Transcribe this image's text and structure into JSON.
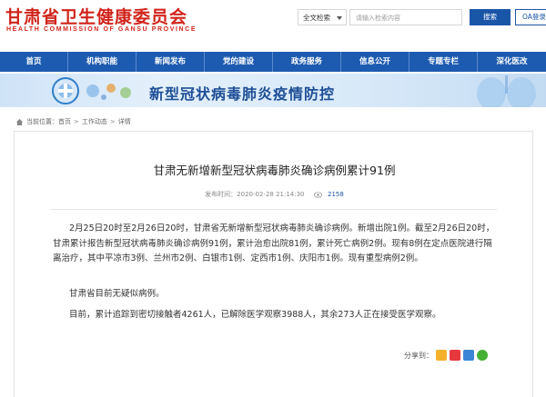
{
  "header": {
    "site_title": "甘肃省卫生健康委员会",
    "site_subtitle": "HEALTH COMMISSION OF GANSU PROVINCE",
    "search_scope": "全文检索",
    "search_placeholder": "请输入检索内容",
    "search_button": "搜索",
    "oa_button": "OA登录"
  },
  "nav": {
    "items": [
      {
        "label": "首页"
      },
      {
        "label": "机构职能"
      },
      {
        "label": "新闻发布"
      },
      {
        "label": "党的建设"
      },
      {
        "label": "政务服务"
      },
      {
        "label": "信息公开"
      },
      {
        "label": "专题专栏"
      },
      {
        "label": "深化医改"
      }
    ]
  },
  "banner": {
    "text": "新型冠状病毒肺炎疫情防控"
  },
  "breadcrumb": {
    "prefix": "当前位置：",
    "items": [
      "首页",
      "工作动态",
      "详情"
    ],
    "separator": ">"
  },
  "article": {
    "title": "甘肃无新增新型冠状病毒肺炎确诊病例累计91例",
    "meta_published": "发布时间：2020-02-28 21:14:30",
    "views": "2158",
    "paragraphs": [
      "2月25日20时至2月26日20时，甘肃省无新增新型冠状病毒肺炎确诊病例。新增出院1例。截至2月26日20时，甘肃累计报告新型冠状病毒肺炎确诊病例91例，累计治愈出院81例，累计死亡病例2例。现有8例在定点医院进行隔离治疗，其中平凉市3例、兰州市2例、白银市1例、定西市1例、庆阳市1例。现有重型病例2例。",
      "甘肃省目前无疑似病例。",
      "目前，累计追踪到密切接触者4261人，已解除医学观察3988人，其余273人正在接受医学观察。"
    ],
    "share_label": "分享到："
  },
  "colors": {
    "brand_red": "#d0241b",
    "nav_blue": "#1d5bb0",
    "link_blue": "#1a56a8"
  }
}
